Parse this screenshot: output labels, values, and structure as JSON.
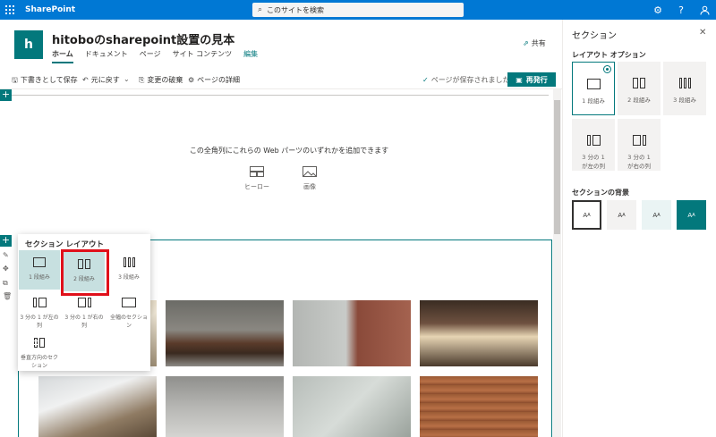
{
  "suitebar": {
    "brand": "SharePoint",
    "search_placeholder": "このサイトを検索",
    "icons": [
      "gear-icon",
      "help-icon",
      "user-icon"
    ],
    "icon_glyphs": [
      "⚙",
      "?",
      "👤"
    ]
  },
  "site": {
    "logo_letter": "h",
    "title": "hitoboのsharepoint設置の見本",
    "nav": [
      {
        "label": "ホーム",
        "active": true
      },
      {
        "label": "ドキュメント"
      },
      {
        "label": "ページ"
      },
      {
        "label": "サイト コンテンツ"
      },
      {
        "label": "編集",
        "edit": true
      }
    ],
    "share": "共有"
  },
  "commandbar": {
    "save_draft": "下書きとして保存",
    "undo": "元に戻す",
    "discard": "変更の破棄",
    "page_details": "ページの詳細",
    "saved_status": "ページが保存されました",
    "republish": "再発行"
  },
  "canvas": {
    "add_webparts_msg": "この全角列にこれらの Web パーツのいずれかを追加できます",
    "webparts": [
      "ヒーロー",
      "画像"
    ]
  },
  "section_layout_popup": {
    "title": "セクション レイアウト",
    "options": [
      {
        "label": "1 段組み",
        "cols": 1
      },
      {
        "label": "2 段組み",
        "cols": 2
      },
      {
        "label": "3 段組み",
        "cols": 3
      },
      {
        "label": "3 分の 1 が左の列",
        "cols": 2
      },
      {
        "label": "3 分の 1 が右の列",
        "cols": 2
      },
      {
        "label": "全幅のセクション",
        "cols": 1
      },
      {
        "label": "垂直方向のセクション",
        "cols": 1
      }
    ]
  },
  "pane": {
    "title": "セクション",
    "layout_options_label": "レイアウト オプション",
    "layout_options": [
      {
        "label": "1 段組み",
        "selected": true
      },
      {
        "label": "2 段組み"
      },
      {
        "label": "3 段組み"
      },
      {
        "label": "3 分の 1 が左の列"
      },
      {
        "label": "3 分の 1 が右の列"
      }
    ],
    "background_label": "セクションの背景",
    "background_glyph": "A",
    "backgrounds": [
      "#ffffff",
      "#f3f2f1",
      "#eaf4f4",
      "#03787c"
    ]
  },
  "colors": {
    "suite": "#0078d4",
    "accent": "#03787c",
    "highlight": "#e0101a"
  }
}
